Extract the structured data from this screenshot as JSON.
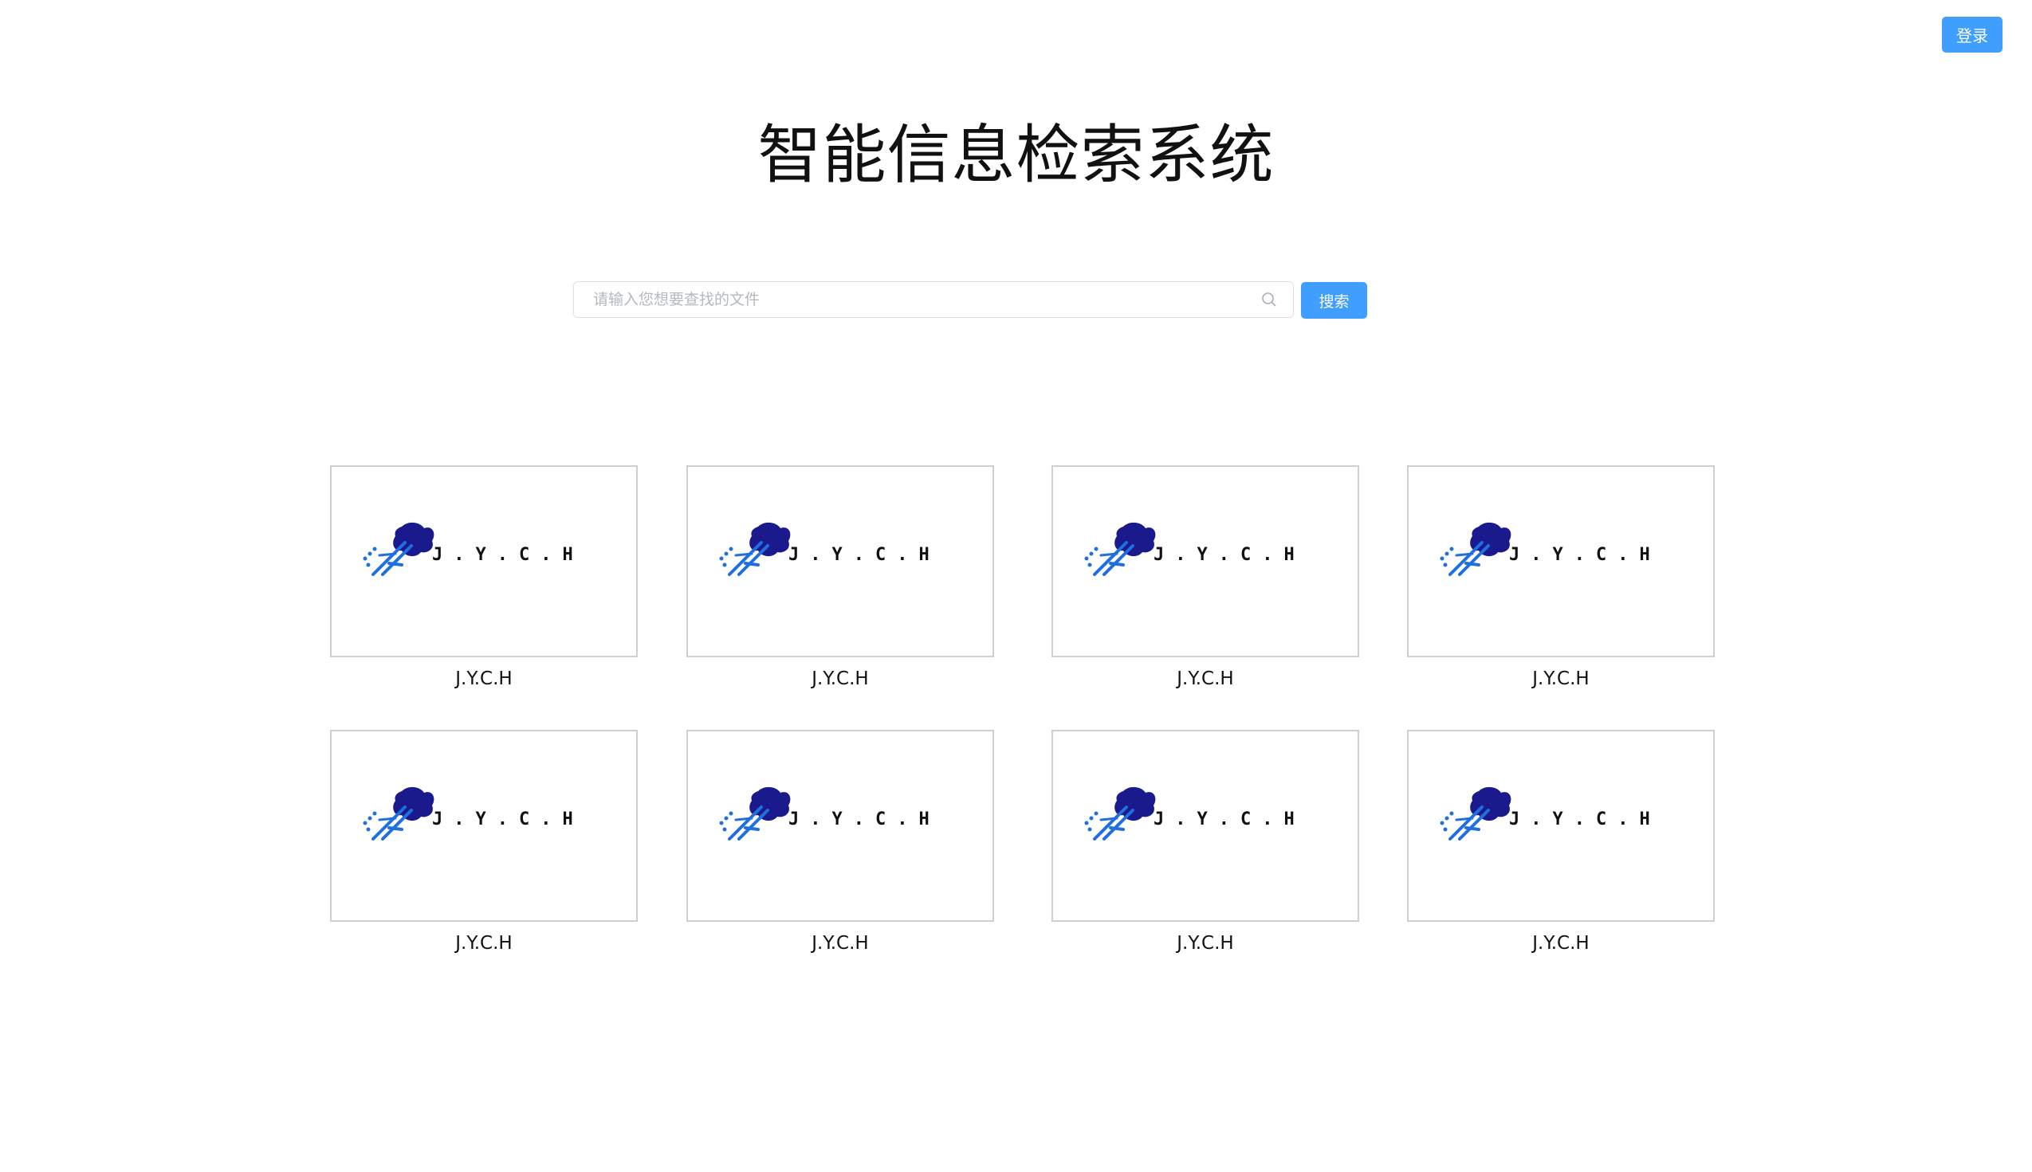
{
  "header": {
    "login_label": "登录"
  },
  "title": "智能信息检索系统",
  "search": {
    "placeholder": "请输入您想要查找的文件",
    "value": "",
    "button_label": "搜索",
    "icon": "search-icon"
  },
  "colors": {
    "primary": "#409eff",
    "logo_dark": "#1a1a8c",
    "logo_light": "#1f6fe0"
  },
  "results": [
    {
      "label": "J.Y.C.H",
      "logo_text": "J.Y.C.H"
    },
    {
      "label": "J.Y.C.H",
      "logo_text": "J.Y.C.H"
    },
    {
      "label": "J.Y.C.H",
      "logo_text": "J.Y.C.H"
    },
    {
      "label": "J.Y.C.H",
      "logo_text": "J.Y.C.H"
    },
    {
      "label": "J.Y.C.H",
      "logo_text": "J.Y.C.H"
    },
    {
      "label": "J.Y.C.H",
      "logo_text": "J.Y.C.H"
    },
    {
      "label": "J.Y.C.H",
      "logo_text": "J.Y.C.H"
    },
    {
      "label": "J.Y.C.H",
      "logo_text": "J.Y.C.H"
    }
  ]
}
